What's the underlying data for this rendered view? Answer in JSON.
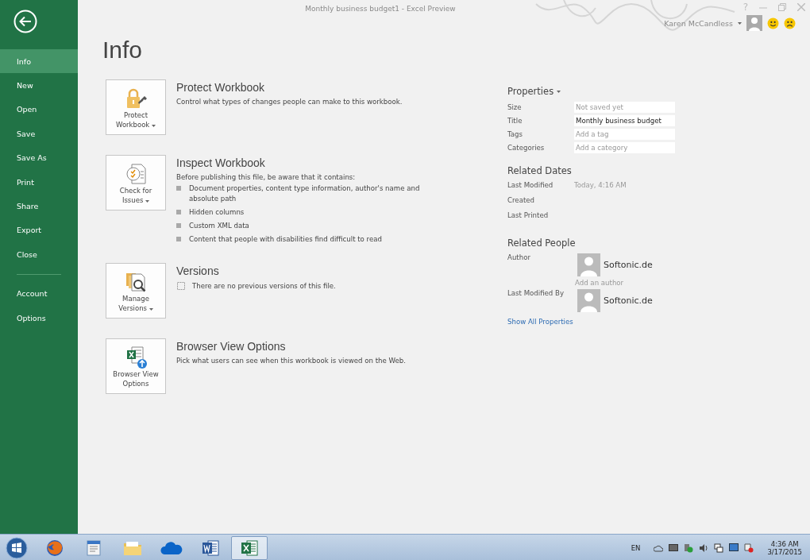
{
  "window": {
    "title": "Monthly business budget1 - Excel Preview",
    "help": "?",
    "user": "Karen McCandless"
  },
  "sidebar": {
    "items": [
      {
        "label": "Info",
        "selected": true,
        "kind": "item"
      },
      {
        "label": "New",
        "selected": false,
        "kind": "item"
      },
      {
        "label": "Open",
        "selected": false,
        "kind": "item"
      },
      {
        "label": "Save",
        "selected": false,
        "kind": "item"
      },
      {
        "label": "Save As",
        "selected": false,
        "kind": "item"
      },
      {
        "label": "Print",
        "selected": false,
        "kind": "item"
      },
      {
        "label": "Share",
        "selected": false,
        "kind": "item"
      },
      {
        "label": "Export",
        "selected": false,
        "kind": "item"
      },
      {
        "label": "Close",
        "selected": false,
        "kind": "item"
      },
      {
        "kind": "divider"
      },
      {
        "label": "Account",
        "selected": false,
        "kind": "item"
      },
      {
        "label": "Options",
        "selected": false,
        "kind": "item"
      }
    ]
  },
  "page_title": "Info",
  "sections": [
    {
      "button": [
        "Protect",
        "Workbook"
      ],
      "dropdown": true,
      "title": "Protect Workbook",
      "description": "Control what types of changes people can make to this workbook."
    },
    {
      "button": [
        "Check for",
        "Issues"
      ],
      "dropdown": true,
      "title": "Inspect Workbook",
      "description": "Before publishing this file, be aware that it contains:",
      "bullets": [
        "Document properties, content type information, author's name and absolute path",
        "Hidden columns",
        "Custom XML data",
        "Content that people with disabilities find difficult to read"
      ]
    },
    {
      "button": [
        "Manage",
        "Versions"
      ],
      "dropdown": true,
      "title": "Versions",
      "note": "There are no previous versions of this file."
    },
    {
      "button": [
        "Browser View",
        "Options"
      ],
      "dropdown": false,
      "title": "Browser View Options",
      "description": "Pick what users can see when this workbook is viewed on the Web."
    }
  ],
  "properties": {
    "heading": "Properties",
    "fields": [
      {
        "label": "Size",
        "value": "Not saved yet",
        "kind": "readonly"
      },
      {
        "label": "Title",
        "value": "Monthly business budget",
        "kind": "editable"
      },
      {
        "label": "Tags",
        "placeholder": "Add a tag",
        "kind": "editable"
      },
      {
        "label": "Categories",
        "placeholder": "Add a category",
        "kind": "editable"
      }
    ]
  },
  "related_dates": {
    "heading": "Related Dates",
    "rows": [
      {
        "label": "Last Modified",
        "value": "Today, 4:16 AM"
      },
      {
        "label": "Created"
      },
      {
        "label": "Last Printed"
      }
    ]
  },
  "related_people": {
    "heading": "Related People",
    "author_label": "Author",
    "author": "Softonic.de",
    "add_author": "Add an author",
    "modified_label": "Last Modified By",
    "modified_by": "Softonic.de"
  },
  "show_all": "Show All Properties",
  "taskbar": {
    "apps": [
      {
        "kind": "firefox",
        "selected": false
      },
      {
        "kind": "document",
        "selected": false
      },
      {
        "kind": "folder",
        "selected": false
      },
      {
        "kind": "cloud",
        "selected": false
      },
      {
        "kind": "word",
        "selected": false
      },
      {
        "kind": "excel",
        "selected": true
      }
    ],
    "language": "EN",
    "time": "4:36 AM",
    "date": "3/17/2015"
  }
}
